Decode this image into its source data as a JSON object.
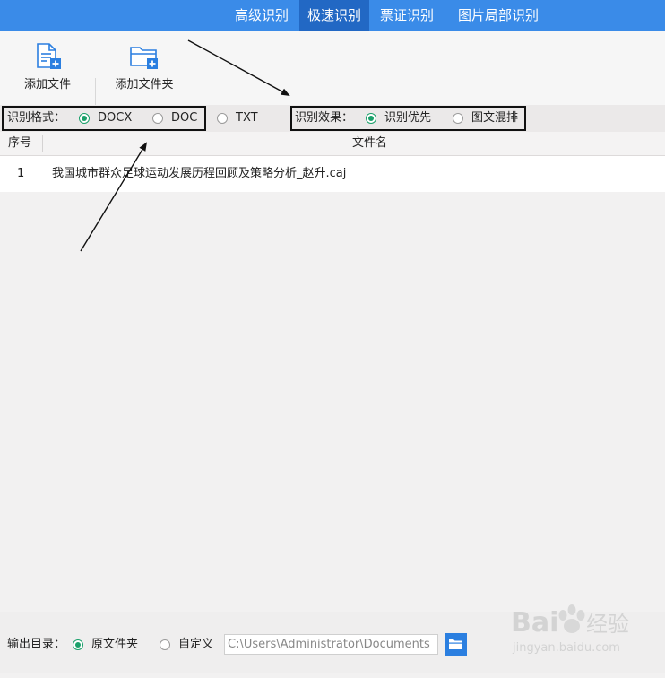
{
  "tabs": [
    {
      "label": "高级识别",
      "active": false
    },
    {
      "label": "极速识别",
      "active": true
    },
    {
      "label": "票证识别",
      "active": false
    },
    {
      "label": "图片局部识别",
      "active": false
    }
  ],
  "toolbar": {
    "add_file_label": "添加文件",
    "add_folder_label": "添加文件夹"
  },
  "options": {
    "format_label": "识别格式：",
    "formats": [
      {
        "label": "DOCX",
        "selected": true
      },
      {
        "label": "DOC",
        "selected": false
      },
      {
        "label": "TXT",
        "selected": false
      }
    ],
    "effect_label": "识别效果：",
    "effects": [
      {
        "label": "识别优先",
        "selected": true
      },
      {
        "label": "图文混排",
        "selected": false
      }
    ]
  },
  "table": {
    "headers": [
      "序号",
      "文件名"
    ],
    "rows": [
      {
        "index": "1",
        "filename": "我国城市群众足球运动发展历程回顾及策略分析_赵升.caj"
      }
    ]
  },
  "footer": {
    "output_label": "输出目录：",
    "option_original": "原文件夹",
    "option_custom": "自定义",
    "path_value": "C:\\Users\\Administrator\\Documents",
    "original_selected": true
  },
  "watermark": {
    "brand": "Bai",
    "brand_suffix": "经验",
    "url": "jingyan.baidu.com"
  },
  "colors": {
    "accent": "#3a8be8",
    "active_tab": "#2268c4",
    "radio_selected": "#1aa06a"
  }
}
